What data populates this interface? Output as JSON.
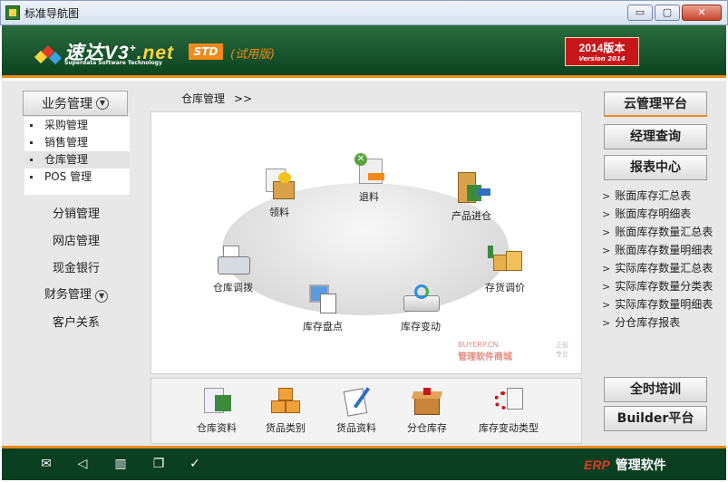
{
  "window": {
    "title": "标准导航图",
    "min": "▭",
    "max": "▢",
    "close": "✕"
  },
  "banner": {
    "logo_name": "速达V3",
    "logo_plus": "+",
    "logo_net": ".net",
    "logo_sub": "Superdata Software Technology",
    "std": "STD",
    "trial": "(试用版)",
    "version": "2014版本",
    "version_en": "Version 2014"
  },
  "left": {
    "header": "业务管理",
    "submenu": [
      "采购管理",
      "销售管理",
      "仓库管理",
      "POS 管理"
    ],
    "links": [
      "分销管理",
      "网店管理",
      "现金银行",
      "财务管理",
      "客户关系"
    ]
  },
  "center": {
    "breadcrumb": "仓库管理",
    "breadcrumb_arrows": ">>",
    "nodes": [
      "领料",
      "退料",
      "产品进仓",
      "仓库调拨",
      "存货调价",
      "库存盘点",
      "库存变动"
    ],
    "watermark_brand": "BUYERP.CN",
    "watermark_text": "管理软件商城",
    "watermark_side": "正规专业",
    "bottom": [
      "仓库资料",
      "货品类别",
      "货品资料",
      "分仓库存",
      "库存变动类型"
    ]
  },
  "right": {
    "buttons_top": [
      "云管理平台",
      "经理查询",
      "报表中心"
    ],
    "reports": [
      "账面库存汇总表",
      "账面库存明细表",
      "账面库存数量汇总表",
      "账面库存数量明细表",
      "实际库存数量汇总表",
      "实际库存数量分类表",
      "实际库存数量明细表",
      "分仓库存报表"
    ],
    "buttons_bottom": [
      "全时培训",
      "Builder平台"
    ]
  },
  "footer": {
    "icons": [
      "mail-icon",
      "speaker-icon",
      "book-icon",
      "documents-icon",
      "check-icon"
    ],
    "erp": "ERP",
    "erp_text": "管理软件"
  },
  "colors": {
    "banner_green": "#0b4420",
    "accent_orange": "#e88a1b",
    "version_red": "#c8171b"
  }
}
